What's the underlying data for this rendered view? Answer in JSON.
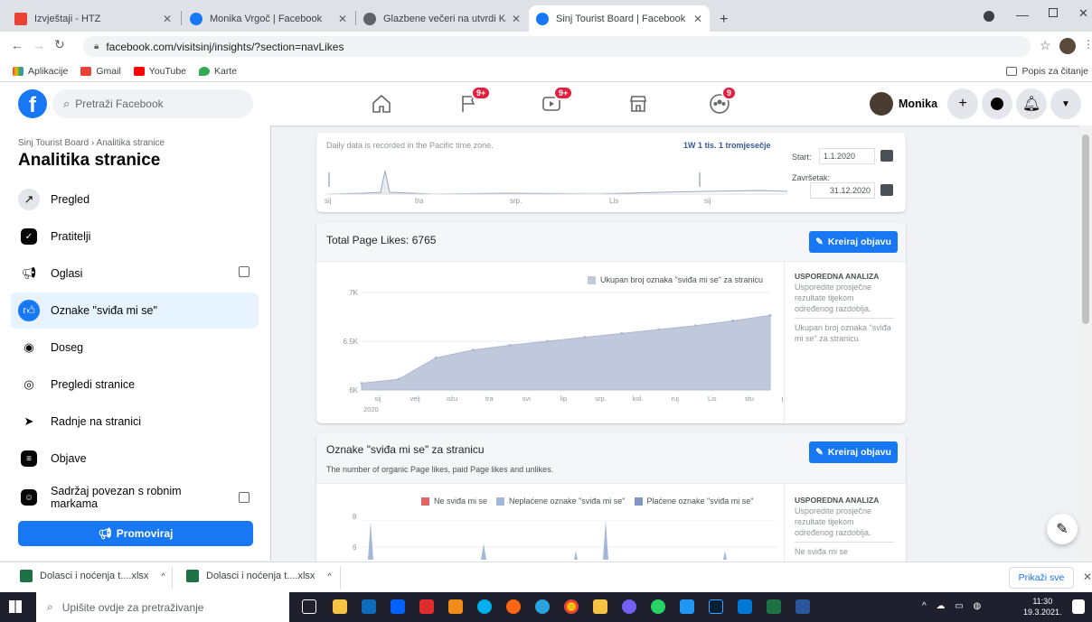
{
  "browser": {
    "tabs": [
      {
        "title": "Izvještaji - HTZ",
        "color": "#ea4335"
      },
      {
        "title": "Monika Vrgoč | Facebook",
        "color": "#1877f2"
      },
      {
        "title": "Glazbene večeri na utvrdi Kamičak",
        "color": "#5f6368"
      },
      {
        "title": "Sinj Tourist Board | Facebook",
        "color": "#1877f2"
      }
    ],
    "url": "facebook.com/visitsinj/insights/?section=navLikes",
    "bookmarks": [
      "Aplikacije",
      "Gmail",
      "YouTube",
      "Karte"
    ],
    "reading_list": "Popis za čitanje"
  },
  "fb": {
    "search_placeholder": "Pretraži Facebook",
    "badges": {
      "pages": "9+",
      "watch": "9+",
      "groups": "9"
    },
    "user_name": "Monika"
  },
  "sidebar": {
    "breadcrumb": "Sinj Tourist Board › Analitika stranice",
    "title": "Analitika stranice",
    "items": [
      {
        "label": "Pregled",
        "icon": "trend-icon"
      },
      {
        "label": "Pratitelji",
        "icon": "followers-icon"
      },
      {
        "label": "Oglasi",
        "icon": "megaphone-icon"
      },
      {
        "label": "Oznake \"sviđa mi se\"",
        "icon": "like-icon"
      },
      {
        "label": "Doseg",
        "icon": "reach-icon"
      },
      {
        "label": "Pregledi stranice",
        "icon": "eye-icon"
      },
      {
        "label": "Radnje na stranici",
        "icon": "cursor-icon"
      },
      {
        "label": "Objave",
        "icon": "posts-icon"
      },
      {
        "label": "Sadržaj povezan s robnim markama",
        "icon": "branded-icon"
      }
    ],
    "promote": "Promoviraj"
  },
  "range": {
    "note": "Daily data is recorded in the Pacific time zone.",
    "links": "1W  1 tis.  1 tromjesečje",
    "start_label": "Start:",
    "start_value": "1.1.2020",
    "end_label": "Završetak:",
    "end_value": "31.12.2020",
    "ticks": [
      "sij",
      "tra",
      "srp.",
      "Lis",
      "sij"
    ]
  },
  "card1": {
    "title": "Total Page Likes: 6765",
    "button": "Kreiraj objavu",
    "legend": "Ukupan broj oznaka \"sviđa mi se\" za stranicu",
    "compare_title": "USPOREDNA ANALIZA",
    "compare_text": "Usporedite prosječne rezultate tijekom određenog razdoblja.",
    "compare_metric": "Ukupan broj oznaka \"sviđa mi se\" za stranicu"
  },
  "card2": {
    "title": "Oznake \"sviđa mi se\" za stranicu",
    "subtitle": "The number of organic Page likes, paid Page likes and unlikes.",
    "button": "Kreiraj objavu",
    "legend": [
      "Ne sviđa mi se",
      "Neplaćene oznake \"sviđa mi se\"",
      "Plaćene oznake \"sviđa mi se\""
    ],
    "legend_colors": [
      "#e06666",
      "#a3b8d8",
      "#7f96c2"
    ],
    "compare_title": "USPOREDNA ANALIZA",
    "compare_text": "Usporedite prosječne rezultate tijekom određenog razdoblja.",
    "compare_metric": "Ne sviđa mi se",
    "yticks": [
      "8",
      "6"
    ]
  },
  "downloads": {
    "items": [
      "Dolasci i noćenja t....xlsx",
      "Dolasci i noćenja t....xlsx"
    ],
    "show_all": "Prikaži sve"
  },
  "taskbar": {
    "search": "Upišite ovdje za pretraživanje",
    "time": "11:30",
    "date": "19.3.2021."
  },
  "chart_data": {
    "type": "area",
    "legend": "Ukupan broj oznaka \"sviđa mi se\" za stranicu",
    "x": [
      "sij",
      "velj",
      "ožu",
      "tra",
      "svi",
      "lip",
      "srp.",
      "kol.",
      "ruj",
      "Lis",
      "stu",
      "pro"
    ],
    "x_sublabel": "2020",
    "y": [
      6070,
      6110,
      6330,
      6410,
      6460,
      6500,
      6540,
      6580,
      6620,
      6660,
      6710,
      6765
    ],
    "yticks": [
      "6K",
      "6.5K",
      "7K"
    ],
    "ylim": [
      6000,
      7000
    ],
    "color": "#c0c9dc"
  }
}
